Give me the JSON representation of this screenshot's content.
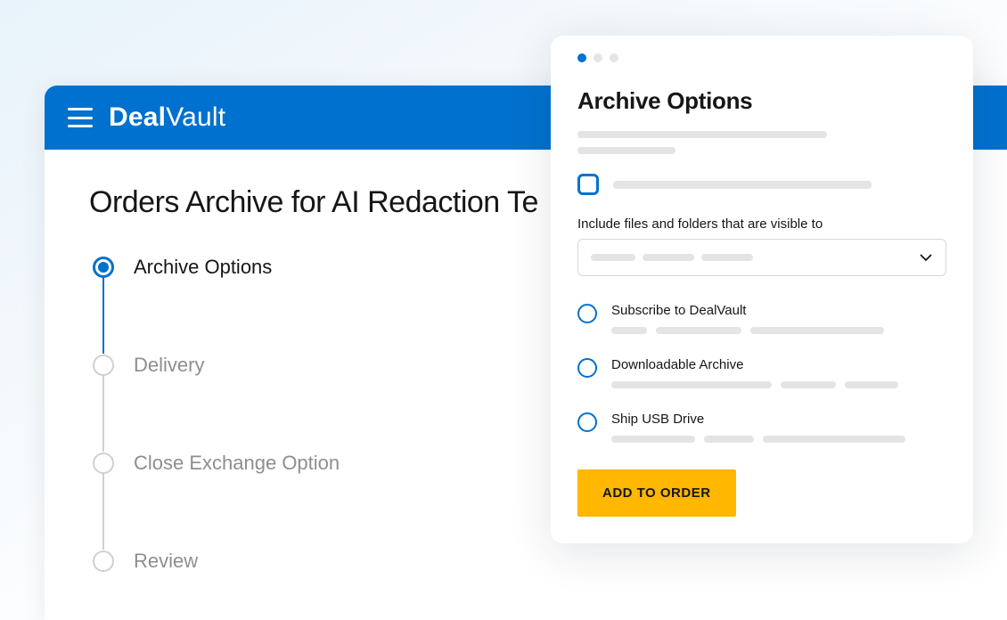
{
  "header": {
    "brand_prefix": "Deal",
    "brand_suffix": "Vault"
  },
  "page": {
    "title": "Orders Archive for AI Redaction Te"
  },
  "stepper": {
    "steps": [
      {
        "label": "Archive Options",
        "active": true
      },
      {
        "label": "Delivery",
        "active": false
      },
      {
        "label": "Close Exchange Option",
        "active": false
      },
      {
        "label": "Review",
        "active": false
      }
    ]
  },
  "modal": {
    "title": "Archive Options",
    "visibility_label": "Include files and folders that are visible to",
    "radios": [
      {
        "label": "Subscribe to DealVault"
      },
      {
        "label": "Downloadable Archive"
      },
      {
        "label": "Ship USB Drive"
      }
    ],
    "button_label": "ADD TO ORDER"
  }
}
